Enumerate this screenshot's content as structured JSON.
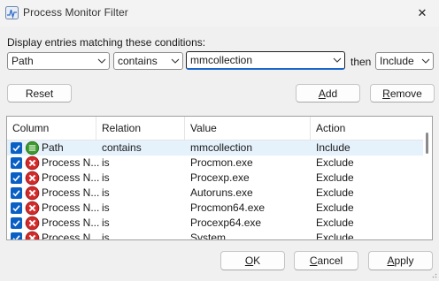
{
  "window": {
    "title": "Process Monitor Filter",
    "close_glyph": "✕"
  },
  "conditions": {
    "caption": "Display entries matching these conditions:",
    "column_value": "Path",
    "relation_value": "contains",
    "value_text": "mmcollection",
    "then_label": "then",
    "action_value": "Include"
  },
  "buttons": {
    "reset": "Reset",
    "add_pre": "",
    "add_ul": "A",
    "add_post": "dd",
    "remove_pre": "",
    "remove_ul": "R",
    "remove_post": "emove",
    "ok_pre": "",
    "ok_ul": "O",
    "ok_post": "K",
    "cancel_pre": "",
    "cancel_ul": "C",
    "cancel_post": "ancel",
    "apply_pre": "",
    "apply_ul": "A",
    "apply_post": "pply"
  },
  "table": {
    "headers": [
      "Column",
      "Relation",
      "Value",
      "Action"
    ],
    "rows": [
      {
        "checked": true,
        "icon": "include-icon",
        "column": "Path",
        "relation": "contains",
        "value": "mmcollection",
        "action": "Include"
      },
      {
        "checked": true,
        "icon": "exclude-icon",
        "column": "Process N...",
        "relation": "is",
        "value": "Procmon.exe",
        "action": "Exclude"
      },
      {
        "checked": true,
        "icon": "exclude-icon",
        "column": "Process N...",
        "relation": "is",
        "value": "Procexp.exe",
        "action": "Exclude"
      },
      {
        "checked": true,
        "icon": "exclude-icon",
        "column": "Process N...",
        "relation": "is",
        "value": "Autoruns.exe",
        "action": "Exclude"
      },
      {
        "checked": true,
        "icon": "exclude-icon",
        "column": "Process N...",
        "relation": "is",
        "value": "Procmon64.exe",
        "action": "Exclude"
      },
      {
        "checked": true,
        "icon": "exclude-icon",
        "column": "Process N...",
        "relation": "is",
        "value": "Procexp64.exe",
        "action": "Exclude"
      },
      {
        "checked": true,
        "icon": "exclude-icon",
        "column": "Process N...",
        "relation": "is",
        "value": "System",
        "action": "Exclude"
      }
    ]
  },
  "colors": {
    "accent": "#0a5fc4",
    "exclude": "#d42a2a",
    "include": "#3a9a2c",
    "selected_row": "#e5f1fb"
  }
}
